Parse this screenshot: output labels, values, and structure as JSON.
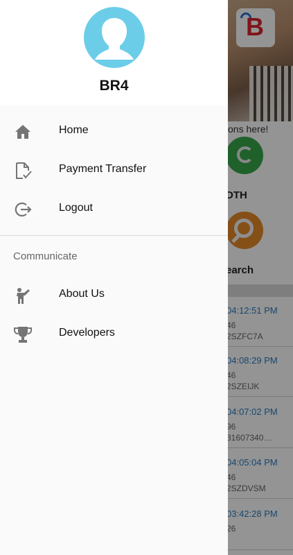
{
  "drawer": {
    "user_name": "BR4",
    "menu": [
      {
        "label": "Home",
        "icon": "home-icon"
      },
      {
        "label": "Payment Transfer",
        "icon": "document-check-icon"
      },
      {
        "label": "Logout",
        "icon": "logout-icon"
      }
    ],
    "section_title": "Communicate",
    "section_menu": [
      {
        "label": "About Us",
        "icon": "person-waving-icon"
      },
      {
        "label": "Developers",
        "icon": "trophy-icon"
      }
    ],
    "colors": {
      "avatar_bg": "#6ccde9",
      "icon_gray": "#757575"
    }
  },
  "background": {
    "operations_text": "ons here!",
    "dth_label": "DTH",
    "search_label": "earch",
    "transactions": [
      {
        "time": "04:12:51 PM",
        "amount": "46",
        "code": "2SZFC7A"
      },
      {
        "time": "04:08:29 PM",
        "amount": "46",
        "code": "2SZEIJK"
      },
      {
        "time": "04:07:02 PM",
        "amount": "96",
        "code": "31607340…"
      },
      {
        "time": "04:05:04 PM",
        "amount": "46",
        "code": "2SZDVSM"
      },
      {
        "time": "03:42:28 PM",
        "amount": "26",
        "code": ""
      }
    ]
  }
}
